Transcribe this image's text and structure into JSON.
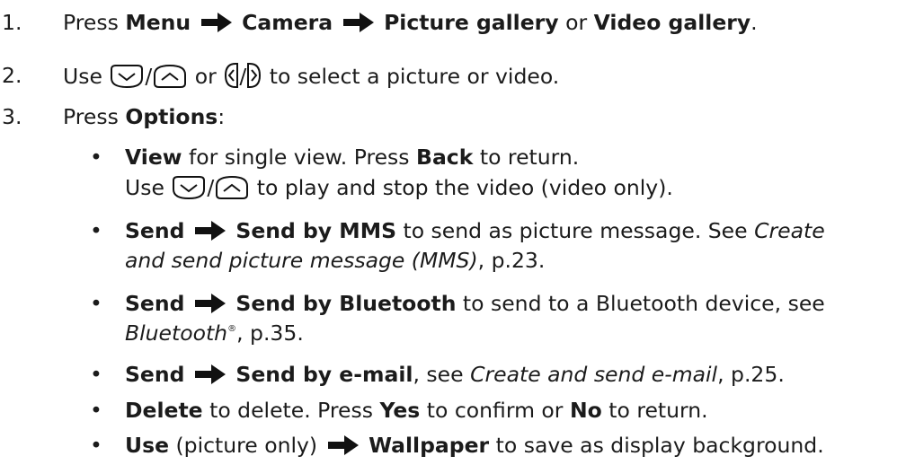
{
  "steps": [
    {
      "number": "1.",
      "press": "Press",
      "menu": "Menu",
      "camera": "Camera",
      "picture_gallery": "Picture gallery",
      "or": "or",
      "video_gallery": "Video gallery",
      "end": "."
    },
    {
      "number": "2.",
      "use": "Use",
      "or": "or",
      "rest": "to select a picture or video."
    },
    {
      "number": "3.",
      "press": "Press",
      "options": "Options",
      "colon": ":"
    }
  ],
  "bullets": {
    "view": {
      "b1": "View",
      "t1": "for single view. Press",
      "b2": "Back",
      "t2": "to return.",
      "use": "Use",
      "rest": "to play and stop the video (video only)."
    },
    "mms": {
      "b1": "Send",
      "b2": "Send by MMS",
      "t1": "to send as picture message. See",
      "i1": "Create",
      "i2": "and send picture message (MMS)",
      "t2": ", p.23."
    },
    "bluetooth": {
      "b1": "Send",
      "b2": "Send by Bluetooth",
      "t1": "to send to a Bluetooth device, see",
      "i1": "Bluetooth",
      "sup": "®",
      "t2": ", p.35."
    },
    "email": {
      "b1": "Send",
      "b2": "Send by e-mail",
      "t1": ", see",
      "i1": "Create and send e-mail",
      "t2": ", p.25."
    },
    "delete": {
      "b1": "Delete",
      "t1": "to delete. Press",
      "b2": "Yes",
      "t2": "to confirm or",
      "b3": "No",
      "t3": "to return."
    },
    "use": {
      "b1": "Use",
      "t1": "(picture only)",
      "b2": "Wallpaper",
      "t2": "to save as display background."
    }
  },
  "bullet_glyph": "•",
  "slash": "/"
}
